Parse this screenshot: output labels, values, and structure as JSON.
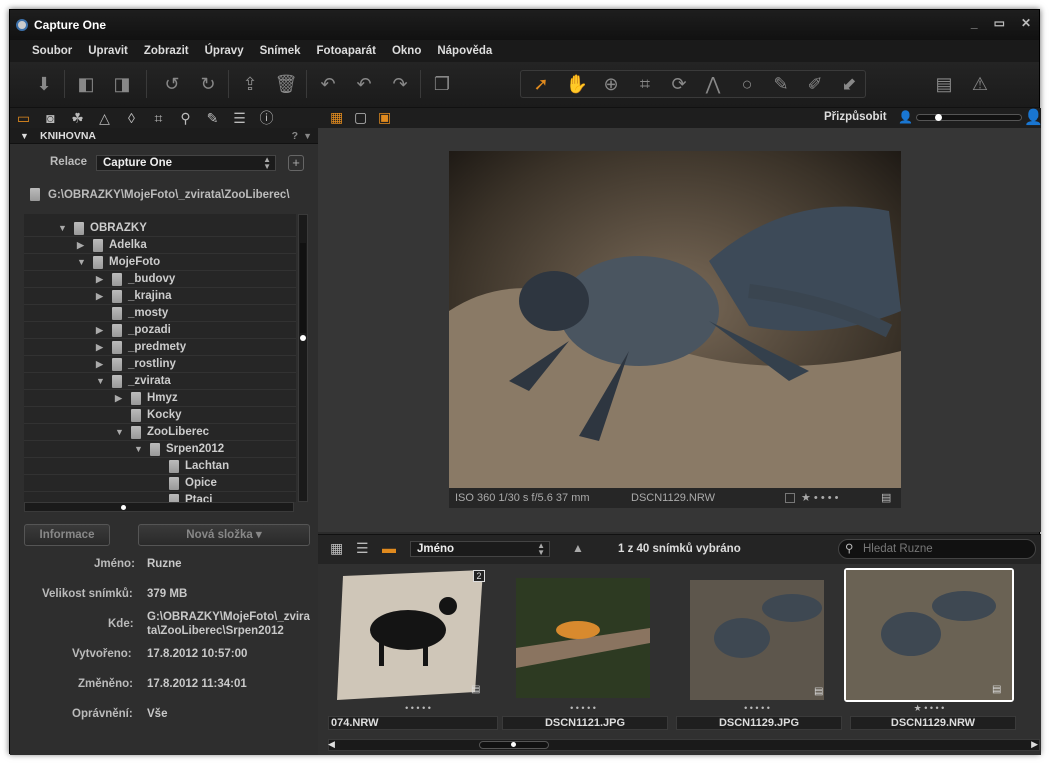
{
  "window": {
    "title": "Capture One",
    "controls": [
      "_",
      "▭",
      "✕"
    ]
  },
  "menu": [
    "Soubor",
    "Upravit",
    "Zobrazit",
    "Úpravy",
    "Snímek",
    "Fotoaparát",
    "Okno",
    "Nápověda"
  ],
  "panel": {
    "section_title": "KNIHOVNA",
    "help": "?",
    "relace_label": "Relace",
    "relace_value": "Capture One",
    "add_label": "+",
    "path": "G:\\OBRAZKY\\MojeFoto\\_zvirata\\ZooLiberec\\",
    "tree": [
      {
        "name": "OBRAZKY",
        "level": 0,
        "state": "open"
      },
      {
        "name": "Adelka",
        "level": 1,
        "state": "closed"
      },
      {
        "name": "MojeFoto",
        "level": 1,
        "state": "open"
      },
      {
        "name": "_budovy",
        "level": 2,
        "state": "closed"
      },
      {
        "name": "_krajina",
        "level": 2,
        "state": "closed"
      },
      {
        "name": "_mosty",
        "level": 2,
        "state": "none"
      },
      {
        "name": "_pozadi",
        "level": 2,
        "state": "closed"
      },
      {
        "name": "_predmety",
        "level": 2,
        "state": "closed"
      },
      {
        "name": "_rostliny",
        "level": 2,
        "state": "closed"
      },
      {
        "name": "_zvirata",
        "level": 2,
        "state": "open"
      },
      {
        "name": "Hmyz",
        "level": 3,
        "state": "closed"
      },
      {
        "name": "Kocky",
        "level": 3,
        "state": "none"
      },
      {
        "name": "ZooLiberec",
        "level": 3,
        "state": "open"
      },
      {
        "name": "Srpen2012",
        "level": 4,
        "state": "open"
      },
      {
        "name": "Lachtan",
        "level": 5,
        "state": "none"
      },
      {
        "name": "Opice",
        "level": 5,
        "state": "none"
      },
      {
        "name": "Ptaci",
        "level": 5,
        "state": "none"
      }
    ],
    "btn_info": "Informace",
    "btn_new_folder": "Nová složka ▾",
    "info": [
      {
        "label": "Jméno:",
        "value": "Ruzne"
      },
      {
        "label": "Velikost snímků:",
        "value": "379 MB"
      },
      {
        "label": "Kde:",
        "value": "G:\\OBRAZKY\\MojeFoto\\_zvirata\\ZooLiberec\\Srpen2012"
      },
      {
        "label": "Vytvořeno:",
        "value": "17.8.2012 10:57:00"
      },
      {
        "label": "Změněno:",
        "value": "17.8.2012 11:34:01"
      },
      {
        "label": "Oprávnění:",
        "value": "Vše"
      }
    ]
  },
  "viewer": {
    "fit_label": "Přizpůsobit",
    "exif": "ISO 360  1/30 s  f/5.6  37 mm",
    "filename": "DSCN1129.NRW",
    "stars": "★ • • • •"
  },
  "browser": {
    "sort_value": "Jméno",
    "count_text": "1 z 40 snímků vybráno",
    "search_placeholder": "Hledat Ruzne",
    "thumbs": [
      {
        "name": "074.NRW",
        "stars": "• • • • •",
        "badge": "2"
      },
      {
        "name": "DSCN1121.JPG",
        "stars": "• • • • •",
        "badge": ""
      },
      {
        "name": "DSCN1129.JPG",
        "stars": "• • • • •",
        "badge": ""
      },
      {
        "name": "DSCN1129.NRW",
        "stars": "★ • • • •",
        "badge": ""
      }
    ]
  },
  "colors": {
    "accent": "#e08a1e",
    "selection": "#ffffff"
  }
}
